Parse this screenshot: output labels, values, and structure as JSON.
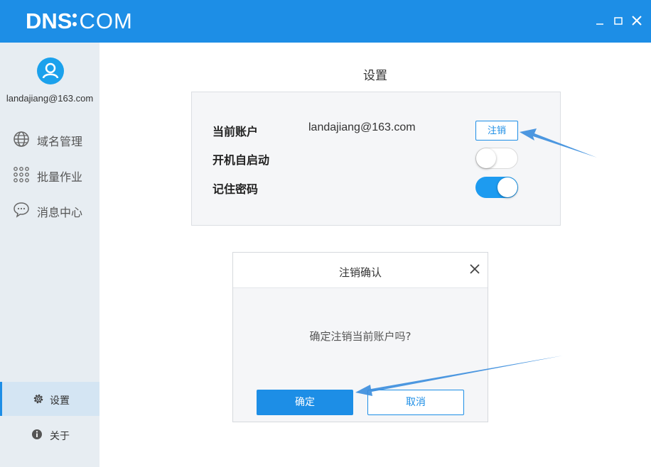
{
  "app": {
    "logo_bold": "DNS",
    "logo_thin": "COM",
    "brand_color": "#1d8ee6"
  },
  "window_controls": {
    "minimize": "minimize-icon",
    "maximize": "maximize-icon",
    "close": "close-icon"
  },
  "sidebar": {
    "user_email": "landajiang@163.com",
    "items": [
      {
        "label": "域名管理",
        "icon": "globe-icon"
      },
      {
        "label": "批量作业",
        "icon": "grid-dots-icon"
      },
      {
        "label": "消息中心",
        "icon": "chat-bubble-icon"
      }
    ],
    "bottom_items": [
      {
        "label": "设置",
        "icon": "gear-icon",
        "active": true
      },
      {
        "label": "关于",
        "icon": "info-icon",
        "active": false
      }
    ]
  },
  "settings": {
    "title": "设置",
    "current_account_label": "当前账户",
    "current_account_value": "landajiang@163.com",
    "logout_label": "注销",
    "autostart_label": "开机自启动",
    "autostart_on": false,
    "remember_password_label": "记住密码",
    "remember_password_on": true
  },
  "dialog": {
    "title": "注销确认",
    "message": "确定注销当前账户吗?",
    "confirm_label": "确定",
    "cancel_label": "取消"
  }
}
